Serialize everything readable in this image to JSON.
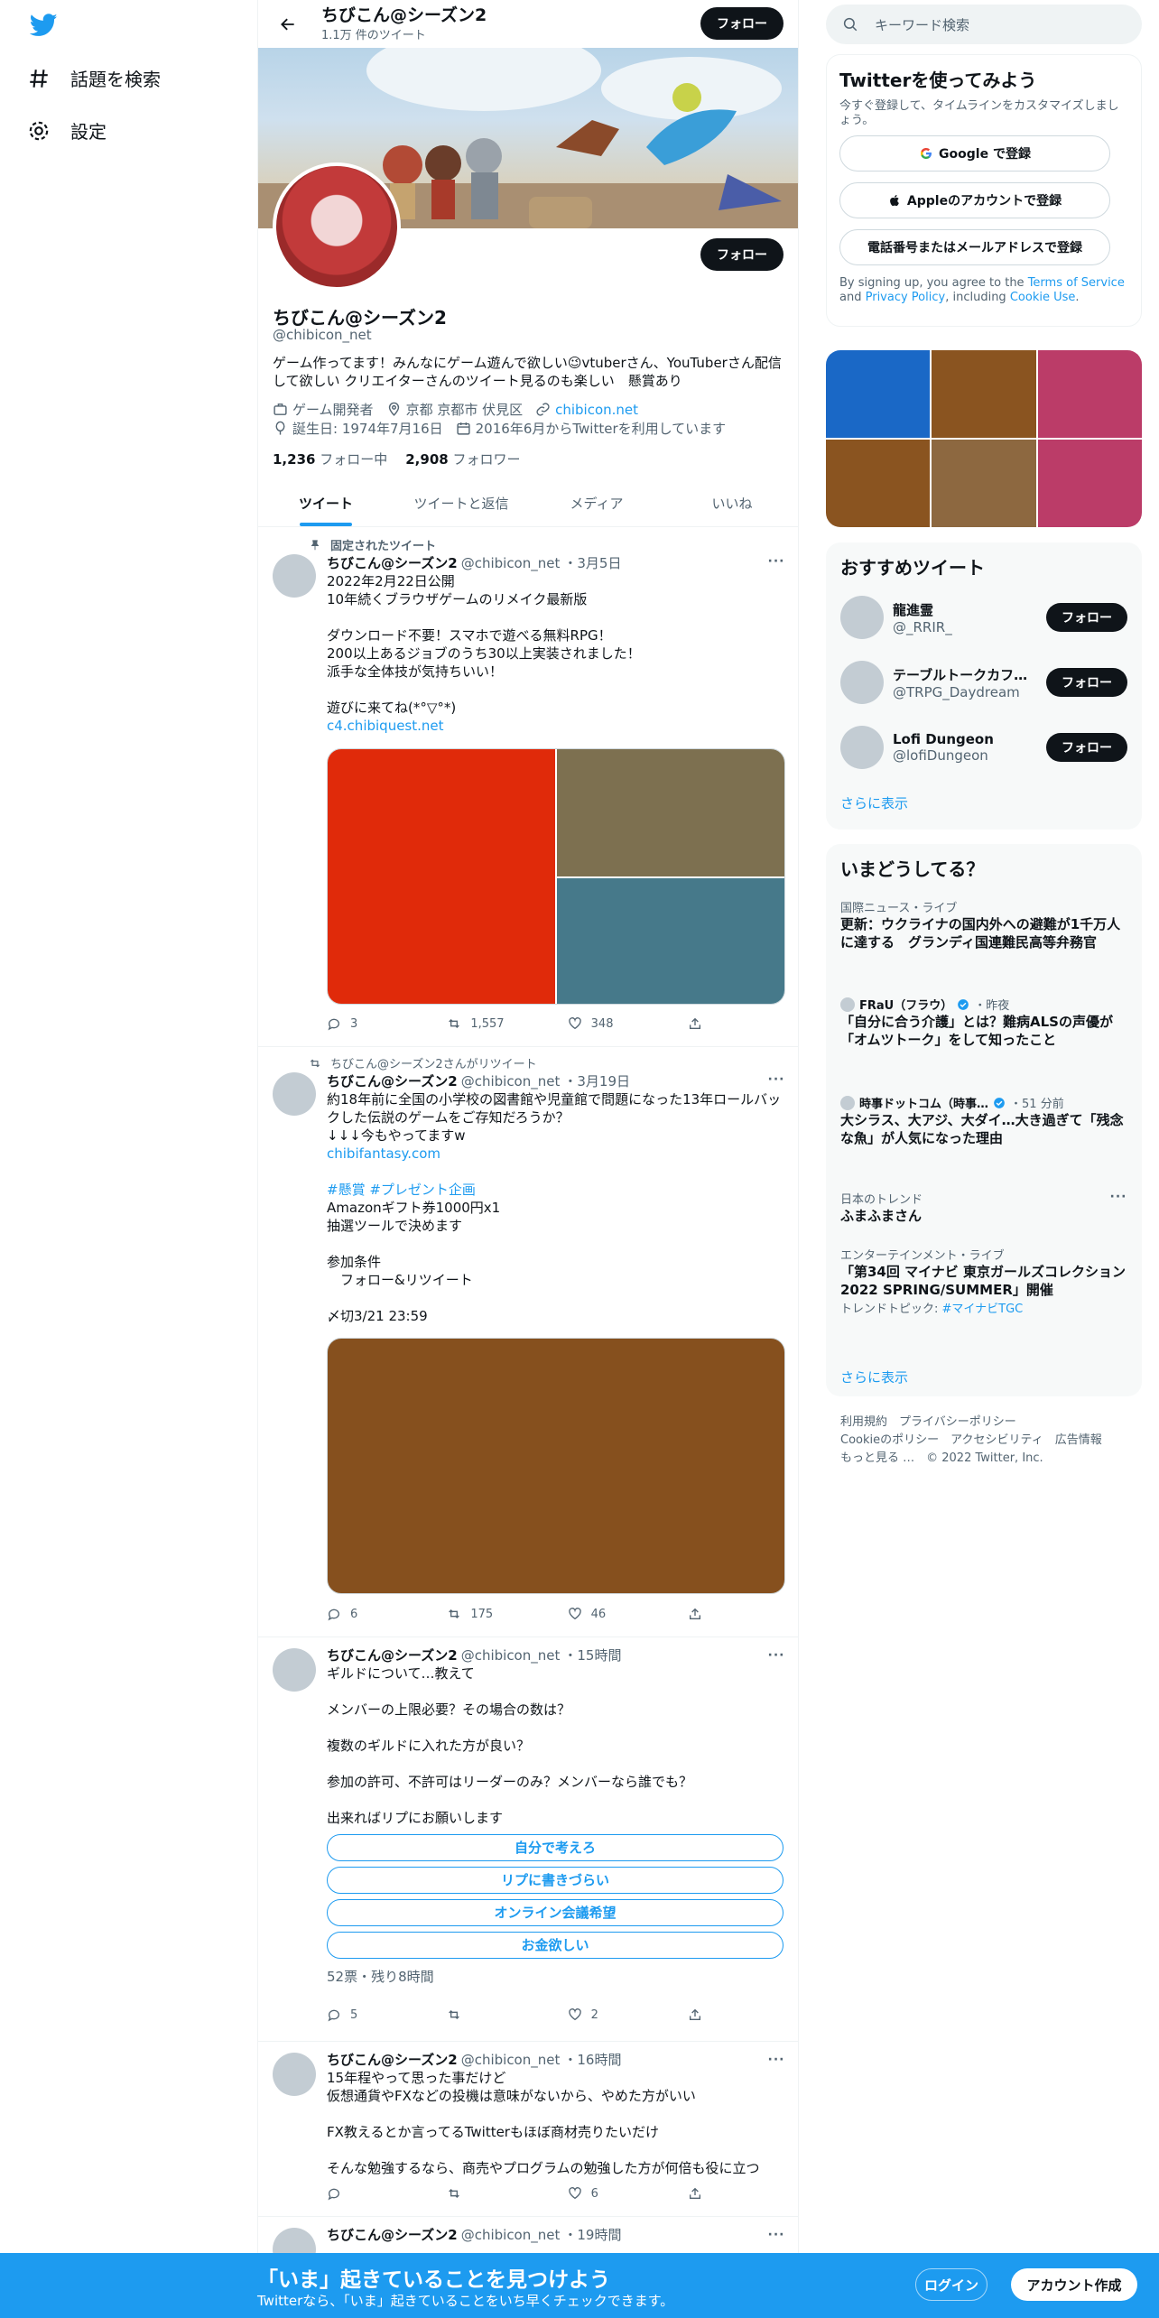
{
  "nav": {
    "explore_label": "話題を検索",
    "settings_label": "設定"
  },
  "header": {
    "title": "ちびこん@シーズン2",
    "tweet_count": "1.1万 件のツイート",
    "follow_label": "フォロー"
  },
  "profile": {
    "name": "ちびこん@シーズン2",
    "handle": "@chibicon_net",
    "bio_line1": "ゲーム作ってます！みんなにゲーム遊んで欲しい😉vtuberさん、YouTuberさん配信",
    "bio_line2": "して欲しい クリエイターさんのツイート見るのも楽しい　懸賞あり",
    "category": "ゲーム開発者",
    "location": "京都 京都市 伏見区",
    "website": "chibicon.net",
    "birthday": "誕生日: 1974年7月16日",
    "joined": "2016年6月からTwitterを利用しています",
    "following_count": "1,236",
    "following_label": "フォロー中",
    "followers_count": "2,908",
    "followers_label": "フォロワー",
    "follow_label": "フォロー"
  },
  "tabs": [
    "ツイート",
    "ツイートと返信",
    "メディア",
    "いいね"
  ],
  "tweets": [
    {
      "social": "固定されたツイート",
      "name": "ちびこん@シーズン2",
      "handle": "@chibicon_net",
      "time": "・3月5日",
      "lines": [
        "2022年2月22日公開",
        "10年続くブラウザゲームのリメイク最新版",
        "",
        "ダウンロード不要！スマホで遊べる無料RPG！",
        "200以上あるジョブのうち30以上実装されました！",
        "派手な全体技が気持ちいい！",
        "",
        "遊びに来てね(*°▽°*)"
      ],
      "link": "c4.chibiquest.net",
      "reply": "3",
      "retweet": "1,557",
      "like": "348"
    },
    {
      "social": "ちびこん@シーズン2さんがリツイート",
      "name": "ちびこん@シーズン2",
      "handle": "@chibicon_net",
      "time": "・3月19日",
      "lines": [
        "約18年前に全国の小学校の図書館や児童館で問題になった13年ロールバッ",
        "クした伝説のゲームをご存知だろうか？",
        "↓↓↓今もやってますw"
      ],
      "link": "chibifantasy.com",
      "hashtags": "#懸賞 #プレゼント企画",
      "lines2": [
        "Amazonギフト券1000円x1",
        "抽選ツールで決めます",
        "",
        "参加条件",
        "　フォロー&リツイート",
        "",
        "〆切3/21 23:59"
      ],
      "reply": "6",
      "retweet": "175",
      "like": "46"
    },
    {
      "name": "ちびこん@シーズン2",
      "handle": "@chibicon_net",
      "time": "・15時間",
      "lines": [
        "ギルドについて…教えて",
        "",
        "メンバーの上限必要？その場合の数は？",
        "",
        "複数のギルドに入れた方が良い？",
        "",
        "参加の許可、不許可はリーダーのみ？メンバーなら誰でも？",
        "",
        "出来ればリプにお願いします"
      ],
      "poll": [
        "自分で考えろ",
        "リプに書きづらい",
        "オンライン会議希望",
        "お金欲しい"
      ],
      "poll_meta": "52票・残り8時間",
      "reply": "5",
      "retweet": "",
      "like": "2"
    },
    {
      "name": "ちびこん@シーズン2",
      "handle": "@chibicon_net",
      "time": "・16時間",
      "lines": [
        "15年程やって思った事だけど",
        "仮想通貨やFXなどの投機は意味がないから、やめた方がいい",
        "",
        "FX教えるとか言ってるTwitterもほぼ商材売りたいだけ",
        "",
        "そんな勉強するなら、商売やプログラムの勉強した方が何倍も役に立つ"
      ],
      "reply": "",
      "retweet": "",
      "like": "6"
    },
    {
      "name": "ちびこん@シーズン2",
      "handle": "@chibicon_net",
      "time": "・19時間"
    }
  ],
  "search": {
    "placeholder": "キーワード検索"
  },
  "signup": {
    "title": "Twitterを使ってみよう",
    "subtitle": "今すぐ登録して、タイムラインをカスタマイズしましょう。",
    "google_label": "Google で登録",
    "apple_label": "Appleのアカウントで登録",
    "phone_label": "電話番号またはメールアドレスで登録",
    "terms_prefix": "By signing up, you agree to the",
    "terms_link": "Terms of Service",
    "terms_and": "and",
    "privacy_link": "Privacy Policy",
    "terms_including": ", including",
    "cookie_link": "Cookie Use",
    "terms_end": "."
  },
  "recommend": {
    "title": "おすすめツイート",
    "users": [
      {
        "name": "龍進霊",
        "handle": "@_RRIR_"
      },
      {
        "name": "テーブルトークカフ…",
        "handle": "@TRPG_Daydream"
      },
      {
        "name": "Lofi Dungeon",
        "handle": "@lofiDungeon"
      }
    ],
    "follow_label": "フォロー",
    "more": "さらに表示"
  },
  "trends": {
    "title": "いまどうしてる？",
    "items": [
      {
        "cat": "国際ニュース・ライブ",
        "text": "更新：ウクライナの国内外への避難が1千万人に達する　グランディ国連難民高等弁務官"
      },
      {
        "source": "FRaU（フラウ）",
        "time": "・昨夜",
        "text": "「自分に合う介護」とは？難病ALSの声優が「オムツトーク」をして知ったこと"
      },
      {
        "source": "時事ドットコム（時事…",
        "time": "・51 分前",
        "text": "大シラス、大アジ、大ダイ…大き過ぎて「残念な魚」が人気になった理由"
      },
      {
        "cat": "日本のトレンド",
        "text": "ふまふまさん"
      },
      {
        "cat": "エンターテインメント・ライブ",
        "text": "「第34回 マイナビ 東京ガールズコレクション 2022 SPRING/SUMMER」開催",
        "topic_prefix": "トレンドトピック: ",
        "topic": "#マイナビTGC"
      }
    ],
    "more": "さらに表示"
  },
  "footer": {
    "line1": "利用規約　プライバシーポリシー",
    "line2": "Cookieのポリシー　アクセシビリティ　広告情報",
    "line3": "もっと見る …　© 2022 Twitter, Inc."
  },
  "bottom": {
    "title": "「いま」起きていることを見つけよう",
    "subtitle": "Twitterなら、「いま」起きていることをいち早くチェックできます。",
    "login": "ログイン",
    "signup": "アカウント作成"
  },
  "colors": {
    "accent": "#1d9bf0",
    "text": "#0f1419",
    "muted": "#536471",
    "media_red": "#e02a0a",
    "media_olive": "#7d7050",
    "media_teal": "#46798a",
    "media_brown": "#86501e",
    "grid": [
      "#1a68c6",
      "#8a5420",
      "#bb3c68",
      "#8a5420",
      "#8d6840",
      "#bb3c68"
    ]
  }
}
